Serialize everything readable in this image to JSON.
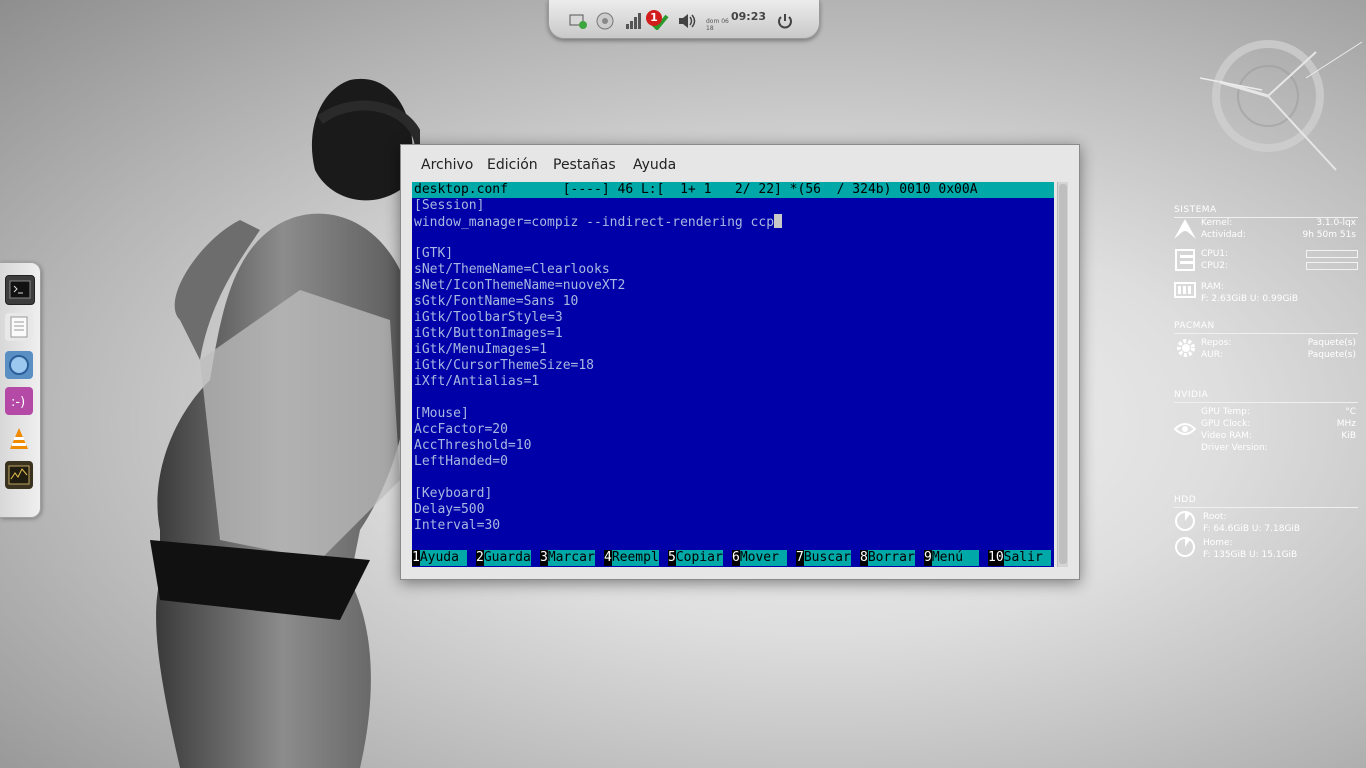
{
  "top_panel": {
    "icons": [
      "network-icon",
      "settings-icon",
      "signal-icon",
      "update-notifier-icon",
      "volume-icon",
      "power-icon"
    ],
    "notification_count": "1",
    "clock_date": "dom 06 18",
    "clock_time": "09:23"
  },
  "dock": {
    "items": [
      "terminal-icon",
      "text-editor-icon",
      "web-browser-icon",
      "chat-icon",
      "vlc-icon",
      "system-monitor-icon"
    ]
  },
  "window": {
    "menu": [
      "Archivo",
      "Edición",
      "Pestañas",
      "Ayuda"
    ],
    "editor": {
      "status_line": "desktop.conf       [----] 46 L:[  1+ 1   2/ 22] *(56  / 324b) 0010 0x00A",
      "lines": [
        "[Session]",
        "window_manager=compiz --indirect-rendering ccp",
        "",
        "[GTK]",
        "sNet/ThemeName=Clearlooks",
        "sNet/IconThemeName=nuoveXT2",
        "sGtk/FontName=Sans 10",
        "iGtk/ToolbarStyle=3",
        "iGtk/ButtonImages=1",
        "iGtk/MenuImages=1",
        "iGtk/CursorThemeSize=18",
        "iXft/Antialias=1",
        "",
        "[Mouse]",
        "AccFactor=20",
        "AccThreshold=10",
        "LeftHanded=0",
        "",
        "[Keyboard]",
        "Delay=500",
        "Interval=30"
      ],
      "fkeys": [
        {
          "num": "1",
          "label": "Ayuda "
        },
        {
          "num": "2",
          "label": "Guarda"
        },
        {
          "num": "3",
          "label": "Marcar"
        },
        {
          "num": "4",
          "label": "Reempl"
        },
        {
          "num": "5",
          "label": "Copiar"
        },
        {
          "num": "6",
          "label": "Mover "
        },
        {
          "num": "7",
          "label": "Buscar"
        },
        {
          "num": "8",
          "label": "Borrar"
        },
        {
          "num": "9",
          "label": "Menú  "
        },
        {
          "num": "10",
          "label": "Salir "
        }
      ]
    }
  },
  "conky": {
    "sistema": {
      "title": "SISTEMA",
      "kernel_label": "Kernel:",
      "kernel_value": "3.1.0-lqx",
      "uptime_label": "Actividad:",
      "uptime_value": "9h 50m 51s",
      "cpu1_label": "CPU1:",
      "cpu2_label": "CPU2:",
      "ram_label": "RAM:",
      "ram_detail": "F: 2.63GiB U: 0.99GiB"
    },
    "pacman": {
      "title": "PACMAN",
      "repos_label": "Repos:",
      "repos_value": "Paquete(s)",
      "aur_label": "AUR:",
      "aur_value": "Paquete(s)"
    },
    "nvidia": {
      "title": "NVIDIA",
      "gpu_temp_label": "GPU Temp:",
      "gpu_temp_unit": "°C",
      "gpu_clock_label": "GPU Clock:",
      "gpu_clock_unit": "MHz",
      "vram_label": "Video RAM:",
      "vram_unit": "KiB",
      "driver_label": "Driver Version:"
    },
    "hdd": {
      "title": "HDD",
      "root_label": "Root:",
      "root_detail": "F: 64.6GiB U: 7.18GiB",
      "home_label": "Home:",
      "home_detail": "F: 135GiB U: 15.1GiB"
    }
  },
  "colors": {
    "terminal_bg": "#0000a8",
    "terminal_fg": "#a8b8e0",
    "accent_cyan": "#00a8a8",
    "conky_blue": "#3aa0e8"
  }
}
